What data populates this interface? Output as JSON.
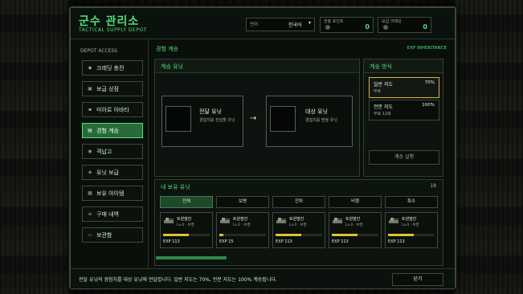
{
  "header": {
    "title": "군수 관리소",
    "subtitle": "TACTICAL SUPPLY DEPOT",
    "language": {
      "label": "언어",
      "value": "한국어"
    },
    "resources": [
      {
        "label": "전술 포인트",
        "value": "0"
      },
      {
        "label": "보급 크레딧",
        "value": "0"
      }
    ]
  },
  "sidebar": {
    "heading": "DEPOT ACCESS",
    "items": [
      {
        "label": "크레딧 충전",
        "icon": "gem-icon"
      },
      {
        "label": "보급 상점",
        "icon": "shop-icon"
      },
      {
        "label": "미아로 아바타",
        "icon": "avatar-icon"
      },
      {
        "label": "경험 계승",
        "icon": "transfer-icon",
        "active": true
      },
      {
        "label": "격납고",
        "icon": "hangar-icon"
      },
      {
        "label": "유닛 보급",
        "icon": "unit-icon"
      },
      {
        "label": "보유 아이템",
        "icon": "item-icon"
      },
      {
        "label": "구매 내역",
        "icon": "receipt-icon"
      },
      {
        "label": "보관함",
        "icon": "storage-icon"
      }
    ]
  },
  "main": {
    "title": "경험 계승",
    "title_en": "EXP INHERITANCE",
    "inherit_panel": {
      "title": "계승 유닛",
      "source": {
        "title": "전달 유닛",
        "desc": "경험치를 전달할 유닛"
      },
      "arrow": "→",
      "target": {
        "title": "대상 유닛",
        "desc": "경험치를 받을 유닛"
      }
    },
    "method_panel": {
      "title": "계승 방식",
      "methods": [
        {
          "name": "일반 지도",
          "pct": "70%",
          "cost": "무료",
          "selected": true
        },
        {
          "name": "전문 지도",
          "pct": "100%",
          "cost": "무료 12회",
          "selected": false
        }
      ],
      "execute_label": "계승 실행"
    },
    "owned_panel": {
      "title": "내 보유 유닛",
      "count": "18",
      "tabs": [
        {
          "label": "전체",
          "active": true
        },
        {
          "label": "보병",
          "active": false
        },
        {
          "label": "전차",
          "active": false
        },
        {
          "label": "비행",
          "active": false
        },
        {
          "label": "특수",
          "active": false
        }
      ],
      "units": [
        {
          "name": "트윈발칸",
          "level": "Lv.4 · 보병",
          "exp": "EXP 113",
          "progress": 0.55
        },
        {
          "name": "트윈발칸",
          "level": "Lv.2 · 보병",
          "exp": "EXP 15",
          "progress": 0.08
        },
        {
          "name": "트윈발칸",
          "level": "Lv.4 · 보병",
          "exp": "EXP 113",
          "progress": 0.55
        },
        {
          "name": "트윈발칸",
          "level": "Lv.4 · 보병",
          "exp": "EXP 113",
          "progress": 0.55
        },
        {
          "name": "트윈발칸",
          "level": "Lv.4 · 보병",
          "exp": "EXP 113",
          "progress": 0.55
        }
      ]
    }
  },
  "footer": {
    "message": "전달 유닛의 경험치를 대상 유닛에 전달합니다. 일반 지도는 70%, 전문 지도는 100% 계승됩니다.",
    "close_label": "닫기"
  },
  "colors": {
    "accent": "#4fe07a",
    "selected_border": "#d4b44a",
    "exp_bar": "#d8c23a"
  }
}
